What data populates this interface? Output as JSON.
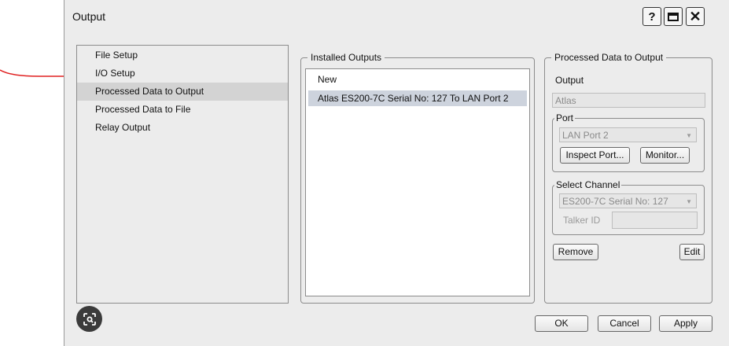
{
  "window": {
    "title": "Output",
    "help_label": "?",
    "maximize_icon": "maximize-icon",
    "close_icon": "close-icon"
  },
  "nav": {
    "items": [
      {
        "label": "File Setup",
        "selected": false
      },
      {
        "label": "I/O Setup",
        "selected": false
      },
      {
        "label": "Processed Data to Output",
        "selected": true
      },
      {
        "label": "Processed Data to File",
        "selected": false
      },
      {
        "label": "Relay Output",
        "selected": false
      }
    ]
  },
  "installed": {
    "legend": "Installed Outputs",
    "items": [
      {
        "label": "New",
        "selected": false
      },
      {
        "label": "Atlas ES200-7C Serial No: 127 To LAN Port 2",
        "selected": true
      }
    ]
  },
  "processed": {
    "legend": "Processed Data to Output",
    "output_label": "Output",
    "output_value": "Atlas",
    "port": {
      "legend": "Port",
      "value": "LAN Port 2",
      "inspect_label": "Inspect Port...",
      "monitor_label": "Monitor..."
    },
    "channel": {
      "legend": "Select Channel",
      "value": "ES200-7C Serial No: 127",
      "talker_label": "Talker ID",
      "talker_value": ""
    },
    "remove_label": "Remove",
    "edit_label": "Edit"
  },
  "footer": {
    "ok_label": "OK",
    "cancel_label": "Cancel",
    "apply_label": "Apply"
  },
  "annotation": {
    "color": "#e02020"
  },
  "colors": {
    "window_bg": "#ececec",
    "selection": "#d3d3d3",
    "list_selection": "#cdd3dd"
  }
}
